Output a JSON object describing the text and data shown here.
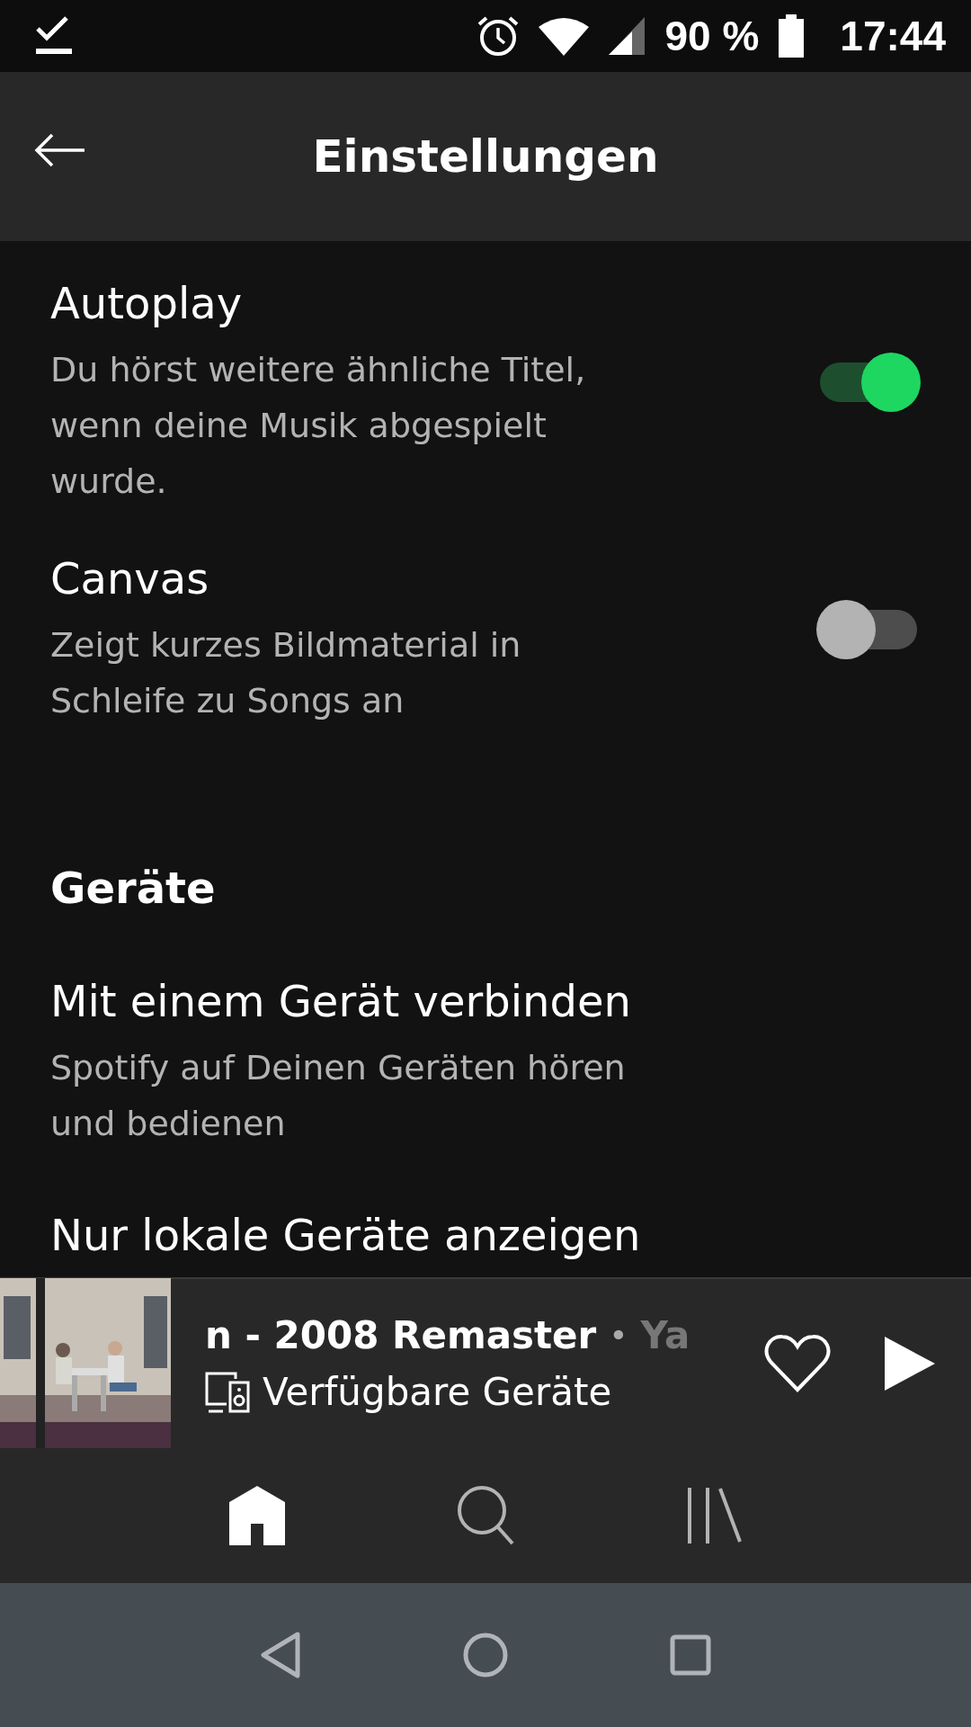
{
  "status_bar": {
    "battery": "90 %",
    "time": "17:44"
  },
  "header": {
    "title": "Einstellungen"
  },
  "settings": [
    {
      "kind": "toggle",
      "title": "Autoplay",
      "description": "Du hörst weitere ähnliche Titel, wenn deine Musik abgespielt wurde.",
      "on": true
    },
    {
      "kind": "toggle",
      "title": "Canvas",
      "description": "Zeigt kurzes Bildmaterial in Schleife zu Songs an",
      "on": false
    },
    {
      "kind": "section",
      "title": "Geräte"
    },
    {
      "kind": "link",
      "title": "Mit einem Gerät verbinden",
      "description": "Spotify auf Deinen Geräten hören und bedienen"
    },
    {
      "kind": "link",
      "title": "Nur lokale Geräte anzeigen"
    }
  ],
  "mini_player": {
    "track": "n - 2008 Remaster",
    "separator": "•",
    "artist": "Ya",
    "device": "Verfügbare Geräte",
    "liked": false
  },
  "bottom_nav": [
    {
      "kind": "home",
      "selected": true
    },
    {
      "kind": "search",
      "selected": false
    },
    {
      "kind": "library",
      "selected": false
    }
  ]
}
